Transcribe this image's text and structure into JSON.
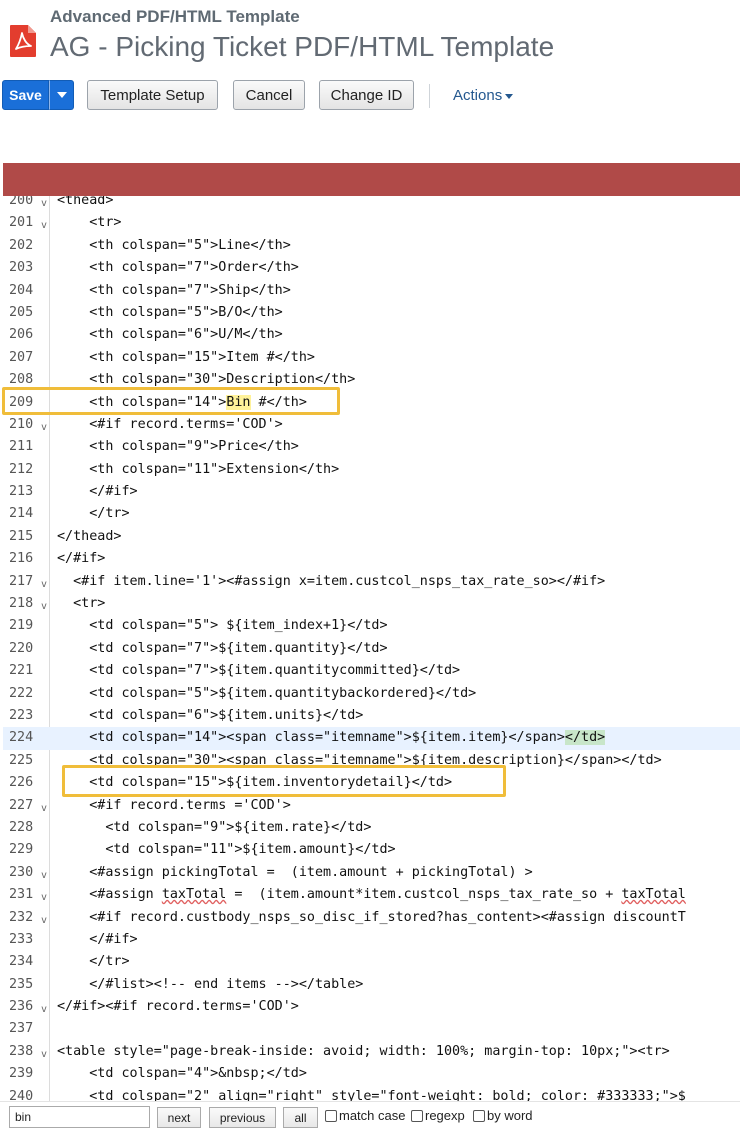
{
  "header": {
    "subtitle": "Advanced PDF/HTML Template",
    "title": "AG - Picking Ticket PDF/HTML Template",
    "icon": "pdf-file-icon"
  },
  "toolbar": {
    "save_label": "Save",
    "template_setup_label": "Template Setup",
    "cancel_label": "Cancel",
    "change_id_label": "Change ID",
    "actions_label": "Actions"
  },
  "colors": {
    "primary_button": "#1a6fd8",
    "banner": "#b04a48",
    "highlight_box": "#f0bd3a"
  },
  "code_lines": [
    {
      "n": "200",
      "fold": true,
      "text": "<thead>"
    },
    {
      "n": "201",
      "fold": true,
      "text": "    <tr>"
    },
    {
      "n": "202",
      "fold": false,
      "text": "    <th colspan=\"5\">Line</th>"
    },
    {
      "n": "203",
      "fold": false,
      "text": "    <th colspan=\"7\">Order</th>"
    },
    {
      "n": "204",
      "fold": false,
      "text": "    <th colspan=\"7\">Ship</th>"
    },
    {
      "n": "205",
      "fold": false,
      "text": "    <th colspan=\"5\">B/O</th>"
    },
    {
      "n": "206",
      "fold": false,
      "text": "    <th colspan=\"6\">U/M</th>"
    },
    {
      "n": "207",
      "fold": false,
      "text": "    <th colspan=\"15\">Item #</th>"
    },
    {
      "n": "208",
      "fold": false,
      "text": "    <th colspan=\"30\">Description</th>"
    },
    {
      "n": "209",
      "fold": false,
      "text": "    <th colspan=\"14\">Bin #</th>"
    },
    {
      "n": "210",
      "fold": true,
      "text": "    <#if record.terms='COD'>"
    },
    {
      "n": "211",
      "fold": false,
      "text": "    <th colspan=\"9\">Price</th>"
    },
    {
      "n": "212",
      "fold": false,
      "text": "    <th colspan=\"11\">Extension</th>"
    },
    {
      "n": "213",
      "fold": false,
      "text": "    </#if>"
    },
    {
      "n": "214",
      "fold": false,
      "text": "    </tr>"
    },
    {
      "n": "215",
      "fold": false,
      "text": "</thead>"
    },
    {
      "n": "216",
      "fold": false,
      "text": "</#if>"
    },
    {
      "n": "217",
      "fold": true,
      "text": "  <#if item.line='1'><#assign x=item.custcol_nsps_tax_rate_so></#if>"
    },
    {
      "n": "218",
      "fold": true,
      "text": "  <tr>"
    },
    {
      "n": "219",
      "fold": false,
      "text": "    <td colspan=\"5\"> ${item_index+1}</td>"
    },
    {
      "n": "220",
      "fold": false,
      "text": "    <td colspan=\"7\">${item.quantity}</td>"
    },
    {
      "n": "221",
      "fold": false,
      "text": "    <td colspan=\"7\">${item.quantitycommitted}</td>"
    },
    {
      "n": "222",
      "fold": false,
      "text": "    <td colspan=\"5\">${item.quantitybackordered}</td>"
    },
    {
      "n": "223",
      "fold": false,
      "text": "    <td colspan=\"6\">${item.units}</td>"
    },
    {
      "n": "224",
      "fold": false,
      "text": "    <td colspan=\"14\"><span class=\"itemname\">${item.item}</span></td>"
    },
    {
      "n": "225",
      "fold": false,
      "text": "    <td colspan=\"30\"><span class=\"itemname\">${item.description}</span></td>"
    },
    {
      "n": "226",
      "fold": false,
      "text": "    <td colspan=\"15\">${item.inventorydetail}</td>"
    },
    {
      "n": "227",
      "fold": true,
      "text": "    <#if record.terms ='COD'>"
    },
    {
      "n": "228",
      "fold": false,
      "text": "      <td colspan=\"9\">${item.rate}</td>"
    },
    {
      "n": "229",
      "fold": false,
      "text": "      <td colspan=\"11\">${item.amount}</td>"
    },
    {
      "n": "230",
      "fold": true,
      "text": "    <#assign pickingTotal =  (item.amount + pickingTotal) >"
    },
    {
      "n": "231",
      "fold": true,
      "text": "    <#assign taxTotal =  (item.amount*item.custcol_nsps_tax_rate_so + taxTotal"
    },
    {
      "n": "232",
      "fold": true,
      "text": "    <#if record.custbody_nsps_so_disc_if_stored?has_content><#assign discountT"
    },
    {
      "n": "233",
      "fold": false,
      "text": "    </#if>"
    },
    {
      "n": "234",
      "fold": false,
      "text": "    </tr>"
    },
    {
      "n": "235",
      "fold": false,
      "text": "    </#list><!-- end items --></table>"
    },
    {
      "n": "236",
      "fold": true,
      "text": "</#if><#if record.terms='COD'>"
    },
    {
      "n": "237",
      "fold": false,
      "text": ""
    },
    {
      "n": "238",
      "fold": true,
      "text": "<table style=\"page-break-inside: avoid; width: 100%; margin-top: 10px;\"><tr>"
    },
    {
      "n": "239",
      "fold": false,
      "text": "    <td colspan=\"4\">&nbsp;</td>"
    },
    {
      "n": "240",
      "fold": false,
      "text": "    <td colspan=\"2\" align=\"right\" style=\"font-weight: bold; color: #333333;\">$"
    }
  ],
  "search": {
    "value": "bin",
    "next_label": "next",
    "previous_label": "previous",
    "all_label": "all",
    "match_case_label": "match case",
    "regexp_label": "regexp",
    "by_word_label": "by word"
  }
}
